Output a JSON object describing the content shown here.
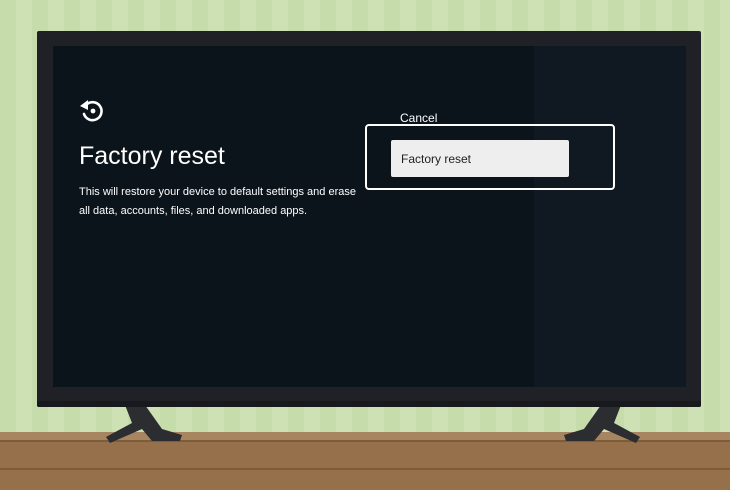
{
  "screen": {
    "icon": "reset-icon",
    "title": "Factory reset",
    "description": "This will restore your device to default settings and erase all data, accounts, files, and downloaded apps.",
    "options": {
      "cancel_label": "Cancel",
      "confirm_label": "Factory reset"
    }
  },
  "colors": {
    "wall": "#c9ddb0",
    "tv_bezel": "#1f2126",
    "screen_bg": "#0b131b",
    "selected_button": "#eeeeee",
    "console_wood": "#96704b"
  }
}
